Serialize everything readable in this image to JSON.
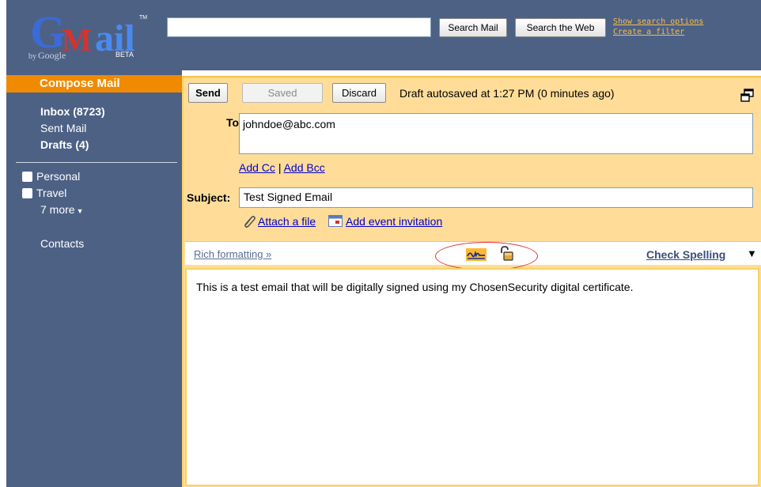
{
  "logo": {
    "product": "Gmail",
    "byline": "by Google",
    "beta": "BETA",
    "tm": "TM",
    "colors": {
      "g_blue": "#3b6bd6",
      "m_red": "#d9322a",
      "ail_blue": "#4a8af0",
      "y_yellow": "#e6b416",
      "gl_green": "#3aa84a"
    }
  },
  "header": {
    "search_value": "",
    "search_mail_label": "Search Mail",
    "search_web_label": "Search the Web",
    "show_search_options": "Show search options",
    "create_filter": "Create a filter",
    "bg_color": "#4d6185",
    "link_color": "#f7bd4a"
  },
  "sidebar": {
    "compose_label": "Compose Mail",
    "inbox_label": "Inbox (8723)",
    "sent_label": "Sent Mail",
    "drafts_label": "Drafts (4)",
    "labels": [
      {
        "name": "Personal"
      },
      {
        "name": "Travel"
      }
    ],
    "more_label": "7 more",
    "contacts_label": "Contacts",
    "accent": "#f08a00"
  },
  "compose": {
    "send_label": "Send",
    "saved_label": "Saved",
    "discard_label": "Discard",
    "autosave_text": "Draft autosaved at 1:27 PM (0 minutes ago)",
    "to_label": "To:",
    "to_value": "johndoe@abc.com",
    "add_cc": "Add Cc",
    "separator": "|",
    "add_bcc": "Add Bcc",
    "subject_label": "Subject:",
    "subject_value": "Test Signed Email",
    "attach_label": "Attach a file",
    "event_label": "Add event invitation",
    "rich_formatting": "Rich formatting »",
    "check_spelling": "Check Spelling",
    "spell_caret": "▼",
    "body_text": "This is a test email that will be digitally signed using my ChosenSecurity digital certificate.",
    "panel_color": "#ffdd99"
  }
}
